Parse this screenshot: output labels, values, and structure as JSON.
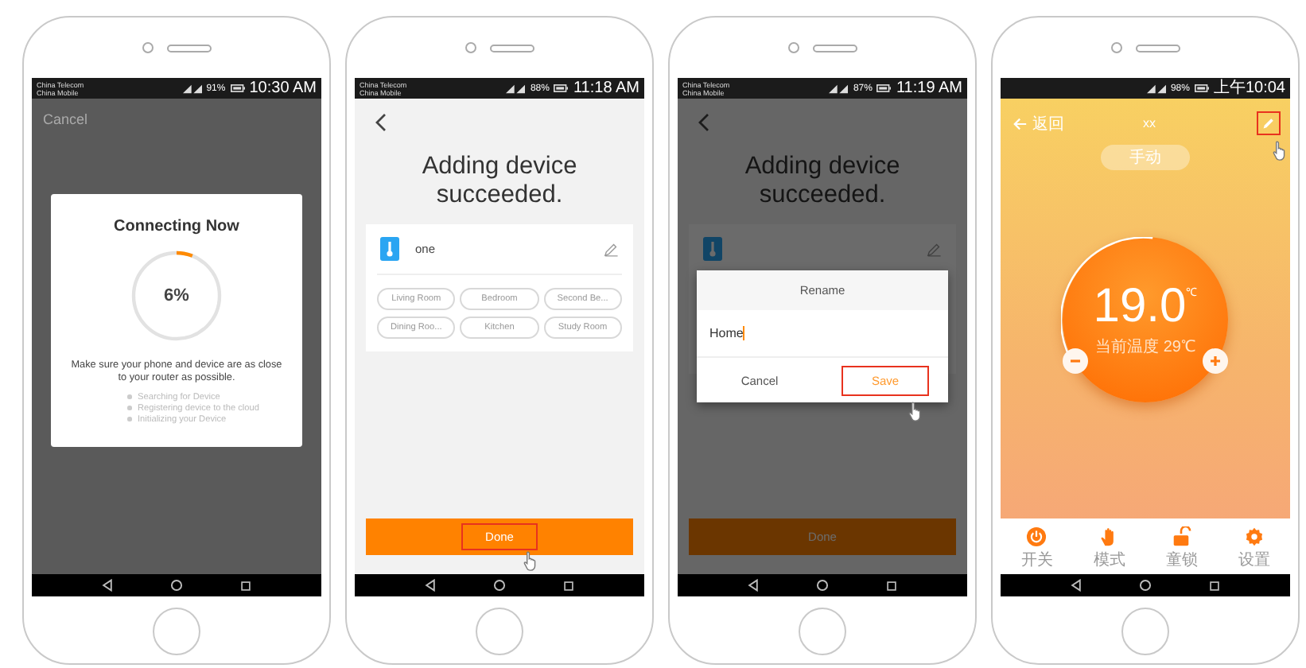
{
  "phones": [
    {
      "kind": "connecting",
      "status": {
        "carriers": [
          "China Telecom",
          "China Mobile"
        ],
        "battery": "91%",
        "time": "10:30 AM"
      },
      "cancel": "Cancel",
      "dialog": {
        "title": "Connecting Now",
        "level": 0.06,
        "percent": "6%",
        "message": "Make sure your phone and device are as close to your router as possible.",
        "steps": [
          "Searching for Device",
          "Registering device to the cloud",
          "Initializing your Device"
        ]
      }
    },
    {
      "kind": "added",
      "status": {
        "carriers": [
          "China Telecom",
          "China Mobile"
        ],
        "battery": "88%",
        "time": "11:18 AM"
      },
      "title": "Adding device succeeded.",
      "device": {
        "name": "one"
      },
      "rooms": [
        "Living Room",
        "Bedroom",
        "Second Be...",
        "Dining Roo...",
        "Kitchen",
        "Study Room"
      ],
      "done": {
        "label": "Done",
        "highlighted": true
      }
    },
    {
      "kind": "rename",
      "status": {
        "carriers": [
          "China Telecom",
          "China Mobile"
        ],
        "battery": "87%",
        "time": "11:19 AM"
      },
      "title": "Adding device succeeded.",
      "rename": {
        "title": "Rename",
        "value": "Home",
        "cancel": "Cancel",
        "save": {
          "label": "Save",
          "highlighted": true
        }
      },
      "done": {
        "label": "Done",
        "highlighted": false
      }
    },
    {
      "kind": "thermostat",
      "status": {
        "battery": "98%",
        "time": "上午10:04"
      },
      "back": "返回",
      "name": "xx",
      "edit_highlighted": true,
      "mode": "手动",
      "temperature": "19.0",
      "unit": "℃",
      "current": "当前温度 29℃",
      "tabs": [
        {
          "kind": "power",
          "label": "开关"
        },
        {
          "kind": "mode",
          "label": "模式"
        },
        {
          "kind": "lock",
          "label": "童锁"
        },
        {
          "kind": "settings",
          "label": "设置"
        }
      ]
    }
  ]
}
